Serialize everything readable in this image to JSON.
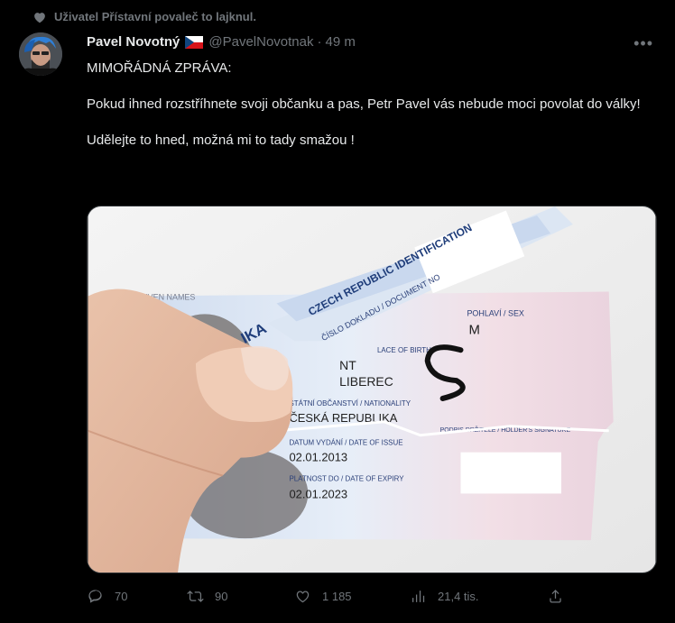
{
  "social_context": {
    "text": "Uživatel Přístavní povaleč to lajknul.",
    "icon": "heart-icon"
  },
  "tweet": {
    "author_name": "Pavel Novotný",
    "author_handle": "@PavelNovotnak",
    "separator": "·",
    "time": "49 m",
    "more_icon": "more-icon",
    "lines": [
      "MIMOŘÁDNÁ ZPRÁVA:",
      "Pokud ihned rozstříhnete svoji občanku a pas, Petr Pavel vás nebude moci povolat do války!",
      "Udělejte to hned, možná mi to tady smažou !"
    ]
  },
  "card": {
    "text_pohlavi": "POHLAVÍ / SEX",
    "text_sex": "M",
    "text_given_names": "/ GIVEN NAMES",
    "text_czech": "CZECH REPUBLIC IDENTIFICATION",
    "text_doc": "ČÍSLO DOKLADU / DOCUMENT NO",
    "text_place": "LACE OF BIRTH",
    "text_city": "LIBEREC",
    "text_nat_label": "STÁTNÍ OBČANSTVÍ / NATIONALITY",
    "text_nat": "ČESKÁ REPUBLIKA",
    "text_issue_label": "DATUM VYDÁNÍ / DATE OF ISSUE",
    "text_issue": "02.01.2013",
    "text_expiry_label": "PLATNOST DO / DATE OF EXPIRY",
    "text_expiry": "02.01.2023",
    "text_signature": "PODPIS DRŽITELE / HOLDER'S SIGNATURE",
    "text_lika": "LIKA",
    "text_nt": "NT"
  },
  "actions": {
    "reply": {
      "icon": "reply-icon",
      "count": "70"
    },
    "retweet": {
      "icon": "retweet-icon",
      "count": "90"
    },
    "like": {
      "icon": "like-icon",
      "count": "1 185"
    },
    "views": {
      "icon": "views-icon",
      "count": "21,4 tis."
    },
    "share": {
      "icon": "share-icon"
    }
  }
}
